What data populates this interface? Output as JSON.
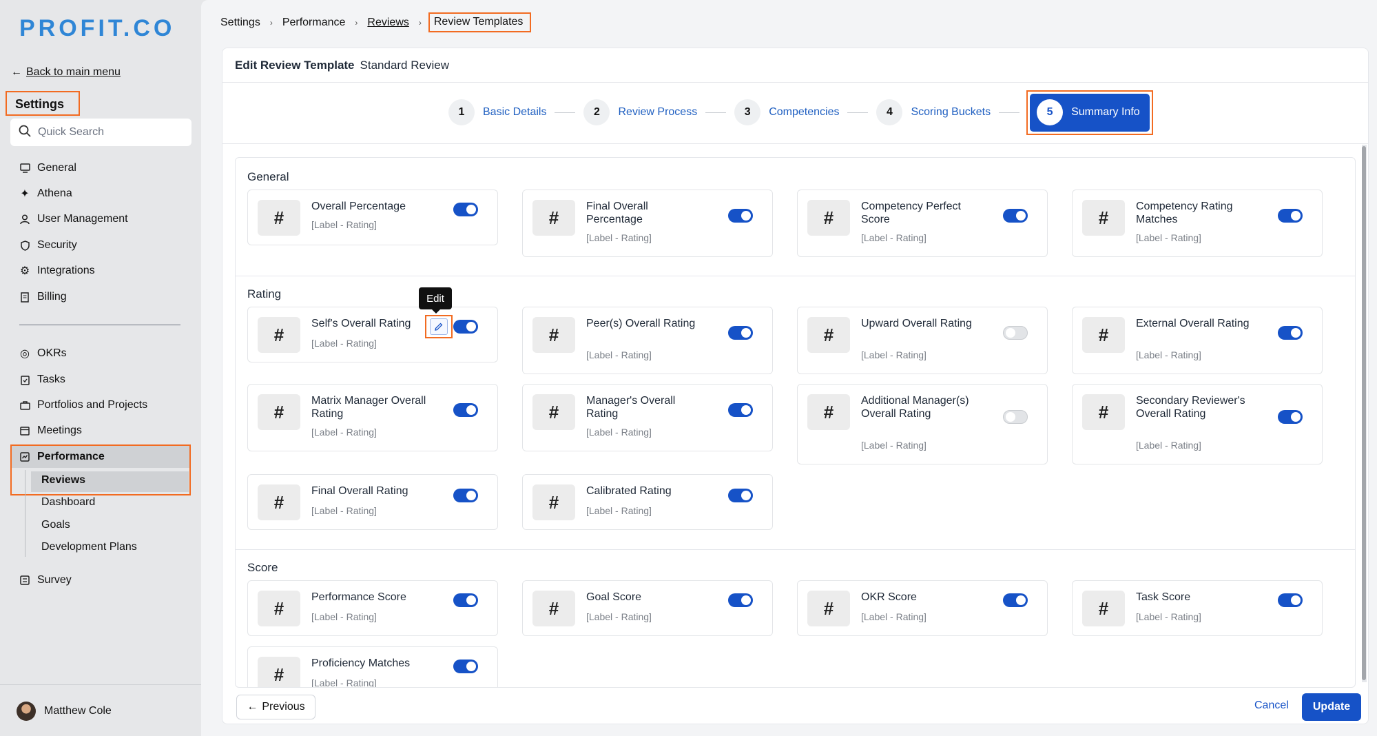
{
  "brand": {
    "logo_text": "PROFIT.CO",
    "accent": "#2f86d6"
  },
  "sidebar": {
    "back_label": "Back to main menu",
    "title": "Settings",
    "search_placeholder": "Quick Search",
    "items": [
      {
        "label": "General",
        "icon": "monitor-icon"
      },
      {
        "label": "Athena",
        "icon": "sparkle-icon"
      },
      {
        "label": "User Management",
        "icon": "user-icon"
      },
      {
        "label": "Security",
        "icon": "shield-icon"
      },
      {
        "label": "Integrations",
        "icon": "gear-icon"
      },
      {
        "label": "Billing",
        "icon": "receipt-icon"
      }
    ],
    "modules": [
      {
        "label": "OKRs",
        "icon": "target-icon"
      },
      {
        "label": "Tasks",
        "icon": "clipboard-icon"
      },
      {
        "label": "Portfolios and Projects",
        "icon": "briefcase-icon"
      },
      {
        "label": "Meetings",
        "icon": "calendar-icon"
      },
      {
        "label": "Performance",
        "icon": "chart-icon"
      }
    ],
    "performance_sub": [
      "Reviews",
      "Dashboard",
      "Goals",
      "Development Plans"
    ],
    "survey": {
      "label": "Survey",
      "icon": "survey-icon"
    },
    "user_name": "Matthew Cole"
  },
  "breadcrumb": [
    "Settings",
    "Performance",
    "Reviews",
    "Review Templates"
  ],
  "panel": {
    "title_label": "Edit Review Template",
    "template_name": "Standard Review"
  },
  "steps": [
    {
      "num": "1",
      "label": "Basic Details"
    },
    {
      "num": "2",
      "label": "Review Process"
    },
    {
      "num": "3",
      "label": "Competencies"
    },
    {
      "num": "4",
      "label": "Scoring Buckets"
    },
    {
      "num": "5",
      "label": "Summary Info"
    }
  ],
  "sections": {
    "general": {
      "title": "General",
      "cards": [
        {
          "name": "Overall Percentage",
          "sub": "[Label - Rating]",
          "on": true
        },
        {
          "name": "Final Overall Percentage",
          "sub": "[Label - Rating]",
          "on": true
        },
        {
          "name": "Competency Perfect Score",
          "sub": "[Label - Rating]",
          "on": true
        },
        {
          "name": "Competency Rating Matches",
          "sub": "[Label - Rating]",
          "on": true
        }
      ]
    },
    "rating": {
      "title": "Rating",
      "cards": [
        {
          "name": "Self's Overall Rating",
          "sub": "[Label - Rating]",
          "on": true
        },
        {
          "name": "Peer(s) Overall Rating",
          "sub": "[Label - Rating]",
          "on": true
        },
        {
          "name": "Upward Overall Rating",
          "sub": "[Label - Rating]",
          "on": false
        },
        {
          "name": "External Overall Rating",
          "sub": "[Label - Rating]",
          "on": true
        },
        {
          "name": "Matrix Manager Overall Rating",
          "sub": "[Label - Rating]",
          "on": true
        },
        {
          "name": "Manager's Overall Rating",
          "sub": "[Label - Rating]",
          "on": true
        },
        {
          "name": "Additional Manager(s) Overall Rating",
          "sub": "[Label - Rating]",
          "on": false
        },
        {
          "name": "Secondary Reviewer's Overall Rating",
          "sub": "[Label - Rating]",
          "on": true
        },
        {
          "name": "Final Overall Rating",
          "sub": "[Label - Rating]",
          "on": true
        },
        {
          "name": "Calibrated Rating",
          "sub": "[Label - Rating]",
          "on": true
        }
      ]
    },
    "score": {
      "title": "Score",
      "cards": [
        {
          "name": "Performance Score",
          "sub": "[Label - Rating]",
          "on": true
        },
        {
          "name": "Goal Score",
          "sub": "[Label - Rating]",
          "on": true
        },
        {
          "name": "OKR Score",
          "sub": "[Label - Rating]",
          "on": true
        },
        {
          "name": "Task Score",
          "sub": "[Label - Rating]",
          "on": true
        },
        {
          "name": "Proficiency Matches",
          "sub": "[Label - Rating]",
          "on": true
        }
      ]
    }
  },
  "card_icon": "#",
  "tooltip": "Edit",
  "footer": {
    "previous": "Previous",
    "cancel": "Cancel",
    "update": "Update"
  },
  "colors": {
    "primary": "#1652c7",
    "highlight": "#f26b21"
  }
}
